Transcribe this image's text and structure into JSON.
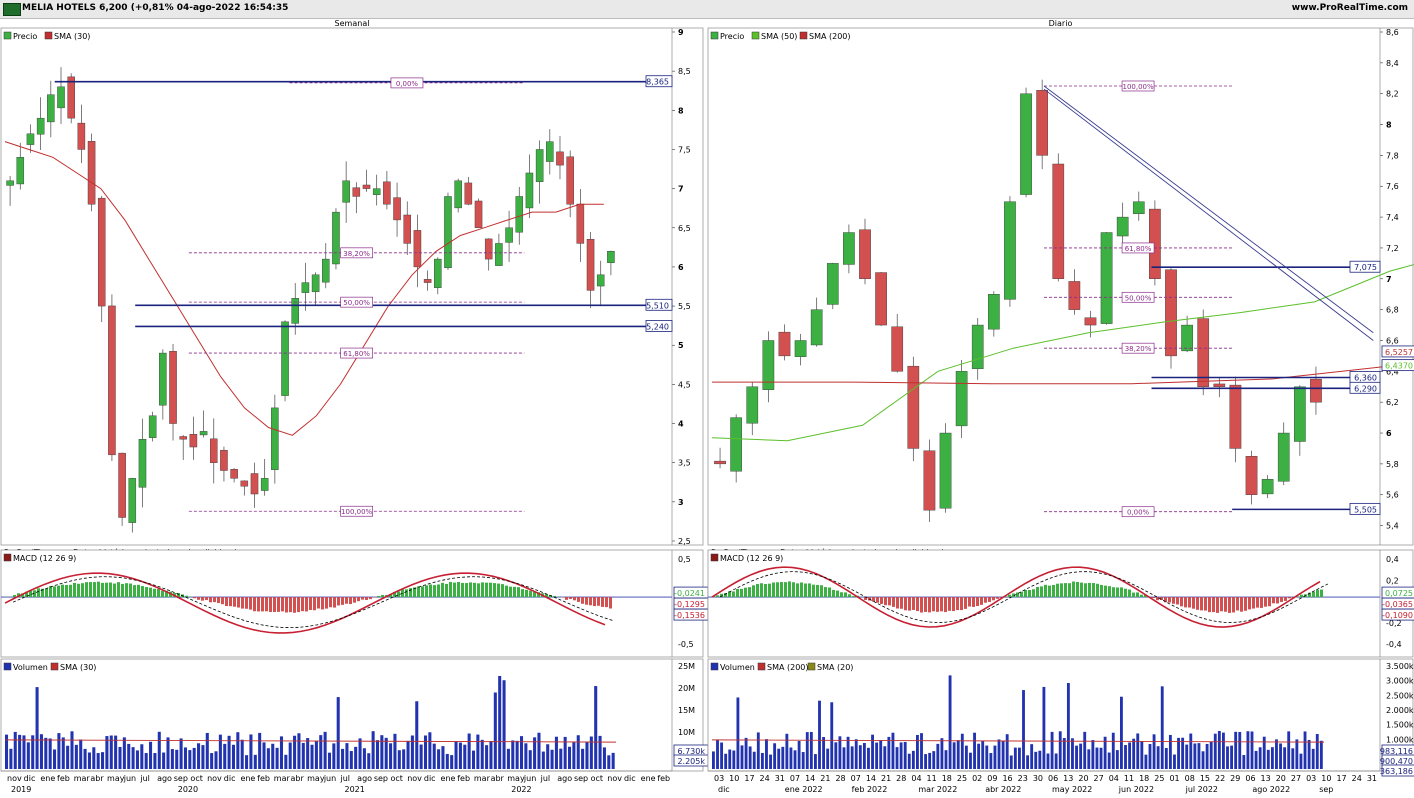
{
  "header": {
    "title": "MELIA HOTELS 6,200 (+0,81% 04-ago-2022 16:54:35",
    "site": "www.ProRealTime.com"
  },
  "colors": {
    "up": "#3cb043",
    "down": "#d25050",
    "sma_red": "#c0302f",
    "sma_green": "#5cbf2a",
    "level_line": "#1a237e",
    "fib": "#8b2d8b",
    "macd_line": "#c62032",
    "signal": "#000000",
    "volume": "#2233b0"
  },
  "weekly": {
    "period_label": "Semanal",
    "legend_price": "Precio",
    "legend_sma": "SMA (30)",
    "source_note": "ProRealTime.comDatos históricos ajustados a los dividendos",
    "y_ticks": [
      "9",
      "8,5",
      "8",
      "7,5",
      "7",
      "6,5",
      "6",
      "5,5",
      "5",
      "4,5",
      "4",
      "3,5",
      "3",
      "2,5"
    ],
    "levels": [
      {
        "value": "8,365"
      },
      {
        "value": "5,510"
      },
      {
        "value": "5,240"
      }
    ],
    "fib": [
      {
        "label": "0,00%"
      },
      {
        "label": "38,20%"
      },
      {
        "label": "50,00%"
      },
      {
        "label": "61,80%"
      },
      {
        "label": "100,00%"
      }
    ],
    "macd_legend": "MACD (12 26 9)",
    "macd_ticks": [
      "0,5",
      "0",
      "-0,5"
    ],
    "macd_values": [
      "-0,0241",
      "-0,1295",
      "-0,1536"
    ],
    "vol_legend": "Volumen",
    "vol_sma_legend": "SMA (30)",
    "vol_ticks": [
      "25M",
      "20M",
      "15M",
      "10M",
      "5.000k"
    ],
    "vol_values": [
      "6.730k",
      "2.205k"
    ],
    "months": [
      "nov",
      "dic",
      "ene",
      "feb",
      "mar",
      "abr",
      "may",
      "jun",
      "jul",
      "ago",
      "sep",
      "oct",
      "nov",
      "dic",
      "ene",
      "feb",
      "mar",
      "abr",
      "may",
      "jun",
      "jul",
      "ago",
      "sep",
      "oct",
      "nov",
      "dic",
      "ene",
      "feb",
      "mar",
      "abr",
      "may",
      "jun",
      "jul",
      "ago",
      "sep",
      "oct",
      "nov",
      "dic",
      "ene",
      "feb"
    ],
    "years": [
      "2019",
      "2020",
      "2021",
      "2022"
    ]
  },
  "daily": {
    "period_label": "Diario",
    "legend_price": "Precio",
    "legend_sma50": "SMA (50)",
    "legend_sma200": "SMA (200)",
    "source_note": "ProRealTime.comDatos históricos ajustados a los dividendos",
    "y_ticks": [
      "8,6",
      "8,4",
      "8,2",
      "8",
      "7,8",
      "7,6",
      "7,4",
      "7,2",
      "7",
      "6,8",
      "6,6",
      "6,4",
      "6,2",
      "6",
      "5,8",
      "5,6",
      "5,4"
    ],
    "levels": [
      {
        "value": "7,075"
      },
      {
        "value": "6,360"
      },
      {
        "value": "6,290"
      },
      {
        "value": "5,505"
      }
    ],
    "sma_values": [
      "6,5257",
      "6,4370"
    ],
    "fib": [
      {
        "label": "100,00%"
      },
      {
        "label": "61,80%"
      },
      {
        "label": "50,00%"
      },
      {
        "label": "38,20%"
      },
      {
        "label": "0,00%"
      }
    ],
    "macd_legend": "MACD (12 26 9)",
    "macd_ticks": [
      "0,4",
      "0,2",
      "0",
      "-0,2",
      "-0,4"
    ],
    "macd_values": [
      "0,0725",
      "-0,0365",
      "-0,1090"
    ],
    "vol_legend": "Volumen",
    "vol_sma200_legend": "SMA (200)",
    "vol_sma20_legend": "SMA (20)",
    "vol_ticks": [
      "3.500k",
      "3.000k",
      "2.500k",
      "2.000k",
      "1.500k",
      "1.000k",
      "500k"
    ],
    "vol_values": [
      "983,116",
      "900,470",
      "363,186"
    ],
    "days": [
      "03",
      "10",
      "17",
      "24",
      "31",
      "07",
      "14",
      "21",
      "28",
      "07",
      "14",
      "21",
      "28",
      "04",
      "11",
      "18",
      "25",
      "02",
      "09",
      "16",
      "23",
      "30",
      "06",
      "13",
      "20",
      "27",
      "04",
      "11",
      "18",
      "25",
      "01",
      "08",
      "15",
      "22",
      "29",
      "06",
      "13",
      "20",
      "27",
      "03",
      "10",
      "17",
      "24",
      "31"
    ],
    "months": [
      "dic",
      "ene 2022",
      "feb 2022",
      "mar 2022",
      "abr 2022",
      "may 2022",
      "jun 2022",
      "jul 2022",
      "ago 2022",
      "sep"
    ]
  },
  "chart_data": [
    {
      "type": "candlestick",
      "title": "Semanal",
      "ylim": [
        2.5,
        9.0
      ],
      "series": [
        {
          "name": "Precio",
          "close": [
            7.1,
            7.4,
            7.7,
            7.9,
            8.2,
            8.3,
            7.9,
            7.5,
            6.8,
            5.5,
            3.6,
            2.8,
            3.3,
            3.8,
            4.1,
            4.9,
            4.0,
            3.8,
            3.7,
            3.9,
            3.5,
            3.4,
            3.3,
            3.2,
            3.1,
            3.3,
            4.2,
            5.3,
            5.6,
            5.8,
            5.9,
            6.1,
            6.7,
            7.1,
            6.9,
            7.0,
            7.0,
            6.8,
            6.6,
            6.3,
            6.0,
            5.8,
            6.1,
            6.9,
            7.1,
            6.8,
            6.5,
            6.1,
            6.3,
            6.5,
            6.9,
            7.2,
            7.5,
            7.6,
            7.3,
            6.8,
            6.3,
            5.7,
            5.9,
            6.2
          ]
        },
        {
          "name": "SMA (30)",
          "values": [
            7.6,
            7.5,
            7.4,
            7.2,
            7.0,
            6.6,
            6.1,
            5.6,
            5.1,
            4.6,
            4.2,
            3.95,
            3.85,
            4.1,
            4.5,
            5.0,
            5.5,
            5.9,
            6.2,
            6.4,
            6.5,
            6.6,
            6.7,
            6.7,
            6.8,
            6.8
          ]
        }
      ],
      "levels": [
        8.365,
        5.51,
        5.24
      ],
      "fibonacci": [
        {
          "label": "0,00%",
          "value": 8.35
        },
        {
          "label": "38,20%",
          "value": 6.18
        },
        {
          "label": "50,00%",
          "value": 5.55
        },
        {
          "label": "61,80%",
          "value": 4.9
        },
        {
          "label": "100,00%",
          "value": 2.88
        }
      ],
      "macd": {
        "legend": "MACD (12 26 9)",
        "values": [
          -0.0241,
          -0.1295,
          -0.1536
        ]
      },
      "volume": {
        "legend": "Volumen",
        "sma": "SMA (30)",
        "last": [
          "6.730k",
          "2.205k"
        ]
      }
    },
    {
      "type": "candlestick",
      "title": "Diario",
      "ylim": [
        5.3,
        8.6
      ],
      "series": [
        {
          "name": "Precio",
          "close": [
            5.8,
            6.1,
            6.3,
            6.6,
            6.5,
            6.6,
            6.8,
            7.1,
            7.3,
            7.0,
            6.7,
            6.4,
            5.9,
            5.5,
            6.0,
            6.4,
            6.7,
            6.9,
            7.5,
            8.2,
            7.8,
            7.0,
            6.8,
            6.7,
            7.3,
            7.4,
            7.5,
            7.0,
            6.5,
            6.7,
            6.3,
            6.3,
            5.9,
            5.6,
            5.7,
            6.0,
            6.3,
            6.2
          ]
        },
        {
          "name": "SMA (50)",
          "values": [
            5.97,
            5.95,
            6.05,
            6.4,
            6.55,
            6.65,
            6.72,
            6.78,
            6.85,
            7.05,
            7.18,
            7.15,
            6.8,
            6.44
          ]
        },
        {
          "name": "SMA (200)",
          "values": [
            6.33,
            6.33,
            6.32,
            6.32,
            6.35,
            6.45,
            6.52,
            6.53
          ]
        }
      ],
      "levels": [
        7.075,
        6.36,
        6.29,
        5.505
      ],
      "fibonacci": [
        {
          "label": "100,00%",
          "value": 8.25
        },
        {
          "label": "61,80%",
          "value": 7.2
        },
        {
          "label": "50,00%",
          "value": 6.88
        },
        {
          "label": "38,20%",
          "value": 6.55
        },
        {
          "label": "0,00%",
          "value": 5.49
        }
      ],
      "macd": {
        "legend": "MACD (12 26 9)",
        "values": [
          0.0725,
          -0.0365,
          -0.109
        ]
      },
      "volume": {
        "legend": "Volumen",
        "sma": [
          "SMA (200)",
          "SMA (20)"
        ],
        "last": [
          "983,116",
          "900,470",
          "363,186"
        ]
      }
    }
  ]
}
